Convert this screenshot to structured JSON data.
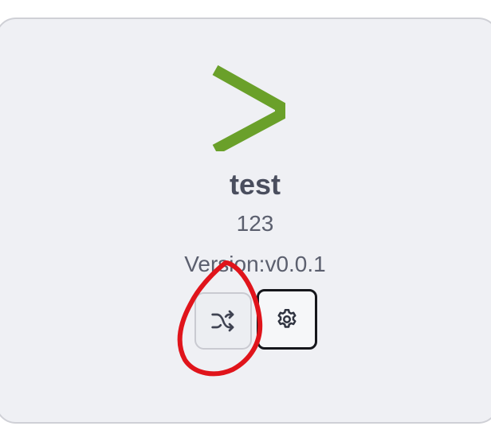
{
  "card": {
    "title": "test",
    "description": "123",
    "version_text": "Version:v0.0.1"
  },
  "icons": {
    "logo": "chevron-right-logo-icon",
    "shuffle": "shuffle-icon",
    "settings": "gear-icon"
  },
  "colors": {
    "logo": "#6aa02a",
    "annotation": "#e0141b",
    "card_bg": "#eff0f4",
    "text_primary": "#4a4e5e",
    "text_secondary": "#5b5f6e"
  }
}
